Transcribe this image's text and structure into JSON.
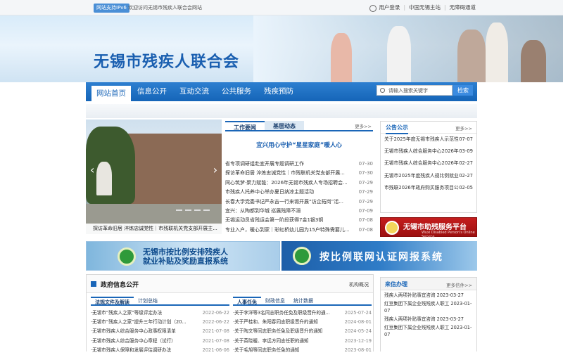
{
  "topbar": {
    "ipv6_label": "网站支持IPv6",
    "welcome": "欢迎访问无锡市残疾人联合会网站",
    "links": [
      "用户登录",
      "中国无锡主站",
      "无障碍通道"
    ]
  },
  "header": {
    "logo_text": "无锡市残疾人联合会"
  },
  "nav": {
    "items": [
      "网站首页",
      "信息公开",
      "互动交流",
      "公共服务",
      "残疾预防"
    ],
    "search_placeholder": "请输入搜索关键字",
    "search_button": "检索"
  },
  "slider": {
    "caption": "探访革命旧居 淬炼忠诚党性｜市残联机关党支部开展主..."
  },
  "news": {
    "tabs": [
      "工作要闻",
      "基层动态"
    ],
    "more": "更多>>",
    "headline": "宜兴用心守护“星星家庭”暖人心",
    "items": [
      {
        "title": "省专项调研组赴宜开展专题调研工作",
        "date": "07-30"
      },
      {
        "title": "探访革命旧居 淬炼忠诚党性｜市残联机关党支部开展...",
        "date": "07-30"
      },
      {
        "title": "同心筑梦·聚力赋能：2026年无锡市残疾人专场招聘会...",
        "date": "07-29"
      },
      {
        "title": "市残疾人托养中心举办夏日纳凉主题活动",
        "date": "07-29"
      },
      {
        "title": "长春大学党委书记严永吉一行来锡开展“访企拓岗”活...",
        "date": "07-29"
      },
      {
        "title": "宜兴：从陶都到华城 巡展残障不溺",
        "date": "07-09"
      },
      {
        "title": "无锡运动员省残运会第一阶段获得7金1银3铜",
        "date": "07-08"
      },
      {
        "title": "专业入户，暖心到家｜彩虹桥幼儿园为15户特殊需要儿...",
        "date": "07-08"
      }
    ]
  },
  "notice": {
    "title": "公告公示",
    "more": "更多>>",
    "items": [
      {
        "title": "关于2025年度无锡市残疾人示范性",
        "date": "07-07"
      },
      {
        "title": "无锡市残疾人综合服务中心2026年",
        "date": "03-09"
      },
      {
        "title": "无锡市残疾人综合服务中心2026年",
        "date": "02-27"
      },
      {
        "title": "无锡市2025年度残疾人规比例就业",
        "date": "02-27"
      },
      {
        "title": "市残联2026年政府购买服务项目公",
        "date": "02-05"
      }
    ]
  },
  "service_badge": {
    "title": "无锡市助残服务平台",
    "subtitle": "Wuxi Disabled Person's Online Service"
  },
  "banner1": {
    "line1": "无锡市按比例安排残疾人",
    "line2": "就业补贴及奖励直报系统"
  },
  "banner2": {
    "text": "按比例联网认证网报系统"
  },
  "gov_info": {
    "title": "政府信息公开",
    "org_link": "机构概况",
    "left_tabs": [
      "法规文件及解读",
      "计划总结"
    ],
    "left_items": [
      {
        "title": "·无锡市“残疾人之家”等级评定办法",
        "date": "2022-06-22"
      },
      {
        "title": "·无锡市“残疾人之家”提升三年行动计划（20...",
        "date": "2022-06-22"
      },
      {
        "title": "·无锡市残疾人综合服务中心政事权限清单",
        "date": "2021-07-08"
      },
      {
        "title": "·无锡市残疾人综合服务中心章程（试行）",
        "date": "2021-07-08"
      },
      {
        "title": "·无锡市残疾人保障和发展评估调研办法",
        "date": "2021-06-06"
      }
    ],
    "right_tabs": [
      "人事任免",
      "财政信息",
      "统计数据"
    ],
    "right_items": [
      {
        "title": "·关于李洋等3名同志职务任免及职级晋升的通...",
        "date": "2025-07-24"
      },
      {
        "title": "·关于严桂和、朱阳春同志职级晋升的通知",
        "date": "2024-08-01"
      },
      {
        "title": "·关于陶文等同志职务任免及职级晋升的通知",
        "date": "2024-05-24"
      },
      {
        "title": "·关于英晓暖、李远方同志任职的通知",
        "date": "2023-12-19"
      },
      {
        "title": "·关于毛旭等同志职务任免的通知",
        "date": "2023-08-01"
      }
    ]
  },
  "letters": {
    "title": "来信办理",
    "more": "更多信件>>",
    "items": [
      {
        "title": "残疾人两项补贴事宜咨询",
        "date": "2023-03-27"
      },
      {
        "title": "红豆集团下属企业残残疾人职工",
        "date": "2023-01-07"
      },
      {
        "title": "残疾人两项补贴事宜咨询",
        "date": "2023-03-27"
      },
      {
        "title": "红豆集团下属企业残残疾人职工",
        "date": "2023-01-07"
      }
    ]
  }
}
